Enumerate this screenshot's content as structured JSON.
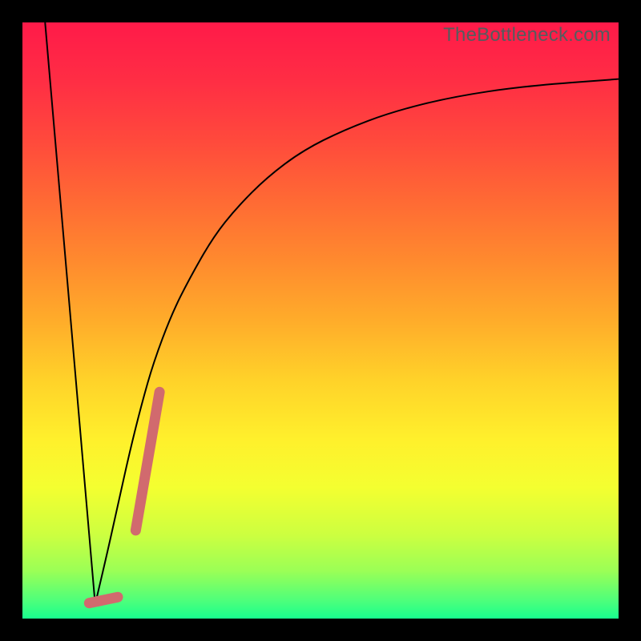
{
  "watermark": "TheBottleneck.com",
  "gradient_stops": [
    {
      "offset": 0.0,
      "color": "#ff1a49"
    },
    {
      "offset": 0.1,
      "color": "#ff2e44"
    },
    {
      "offset": 0.2,
      "color": "#ff4a3c"
    },
    {
      "offset": 0.3,
      "color": "#ff6a34"
    },
    {
      "offset": 0.4,
      "color": "#ff8a2e"
    },
    {
      "offset": 0.5,
      "color": "#ffac2a"
    },
    {
      "offset": 0.6,
      "color": "#ffd229"
    },
    {
      "offset": 0.7,
      "color": "#fff02c"
    },
    {
      "offset": 0.78,
      "color": "#f4ff30"
    },
    {
      "offset": 0.86,
      "color": "#ccff40"
    },
    {
      "offset": 0.92,
      "color": "#9bff56"
    },
    {
      "offset": 0.97,
      "color": "#4dff7b"
    },
    {
      "offset": 1.0,
      "color": "#18ff8e"
    }
  ],
  "chart_data": {
    "type": "line",
    "title": "",
    "xlabel": "",
    "ylabel": "",
    "xlim": [
      0,
      100
    ],
    "ylim": [
      0,
      100
    ],
    "grid": false,
    "legend": false,
    "series": [
      {
        "name": "left-descent",
        "stroke": "#000000",
        "stroke_width": 2,
        "x": [
          3.8,
          12.2
        ],
        "y": [
          100,
          2.4
        ]
      },
      {
        "name": "right-curve",
        "stroke": "#000000",
        "stroke_width": 2,
        "x": [
          12.2,
          14,
          16,
          18,
          20,
          22,
          25,
          28,
          32,
          36,
          41,
          47,
          54,
          62,
          72,
          84,
          100
        ],
        "y": [
          2.4,
          10,
          19,
          28,
          36,
          43,
          51,
          57,
          64,
          69,
          74,
          78.5,
          82,
          85,
          87.5,
          89.3,
          90.5
        ]
      },
      {
        "name": "pink-stroke-diagonal",
        "stroke": "#d16a6e",
        "stroke_width": 13,
        "linecap": "round",
        "x": [
          19.0,
          23.0
        ],
        "y": [
          14.8,
          38.0
        ]
      },
      {
        "name": "pink-stroke-bottom",
        "stroke": "#d16a6e",
        "stroke_width": 13,
        "linecap": "round",
        "x": [
          11.2,
          16.0
        ],
        "y": [
          2.6,
          3.6
        ]
      }
    ]
  }
}
